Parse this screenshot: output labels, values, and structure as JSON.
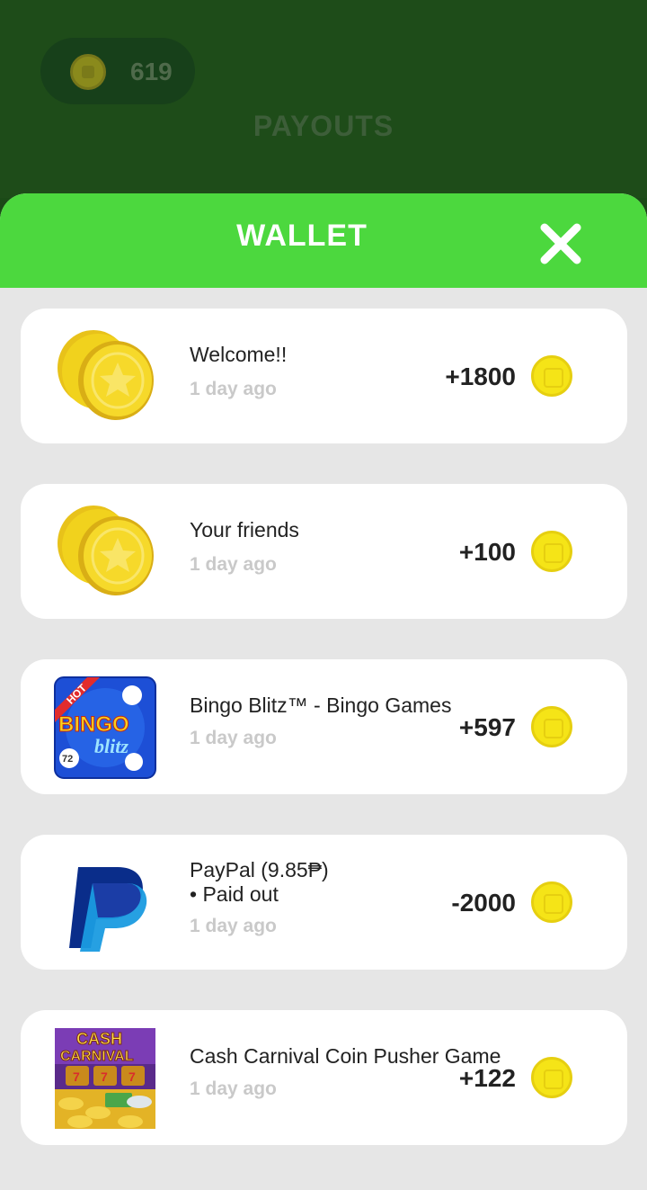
{
  "header": {
    "balance": "619",
    "title": "PAYOUTS"
  },
  "sheet": {
    "title": "WALLET",
    "close_icon": "close-x-icon"
  },
  "transactions": [
    {
      "icon": "gold-coins-icon",
      "title": "Welcome!!",
      "time": "1 day ago",
      "amount": "+1800"
    },
    {
      "icon": "gold-coins-icon",
      "title": "Your friends",
      "time": "1 day ago",
      "amount": "+100"
    },
    {
      "icon": "bingo-blitz-app-icon",
      "title": "Bingo Blitz™ - Bingo Games",
      "time": "1 day ago",
      "amount": "+597",
      "icon_text": [
        "HOT",
        "BINGO",
        "blitz",
        "72"
      ]
    },
    {
      "icon": "paypal-icon",
      "title": "PayPal (9.85₱)",
      "subtitle": "• Paid out",
      "time": "1 day ago",
      "amount": "-2000"
    },
    {
      "icon": "cash-carnival-app-icon",
      "title": "Cash Carnival Coin Pusher Game",
      "time": "1 day ago",
      "amount": "+122",
      "icon_text": [
        "CASH",
        "CARNIVAL"
      ]
    }
  ],
  "colors": {
    "top_bg": "#1e4c19",
    "header_green": "#4cd83e",
    "sheet_bg": "#e6e6e6",
    "coin_yellow": "#f5e417"
  }
}
